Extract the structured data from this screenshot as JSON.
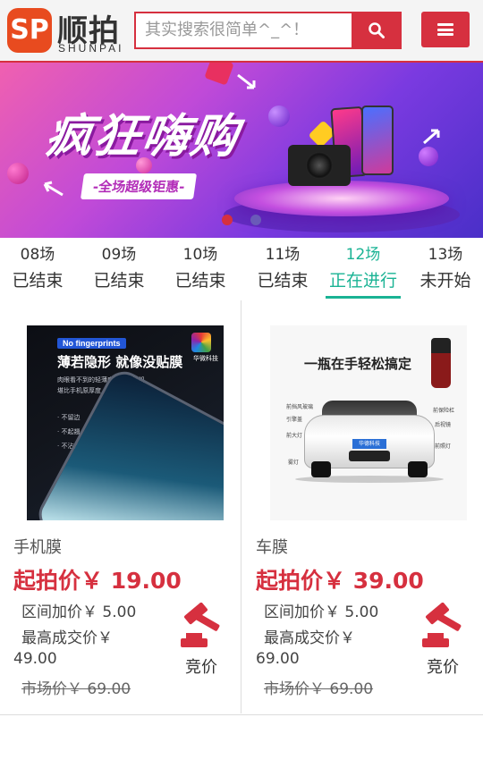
{
  "header": {
    "logo_mark": "SP",
    "logo_cn": "顺拍",
    "logo_en": "SHUNPAI",
    "search_placeholder": "其实搜索很简单^_^！",
    "search_icon": "search-icon",
    "menu_icon": "hamburger-menu-icon",
    "accent_color": "#d6303f"
  },
  "banner": {
    "title": "疯狂嗨购",
    "subtitle": "-全场超级钜惠-",
    "slide_count": 2,
    "active_slide": 1
  },
  "sessions": [
    {
      "time": "08场",
      "status": "已结束"
    },
    {
      "time": "09场",
      "status": "已结束"
    },
    {
      "time": "10场",
      "status": "已结束"
    },
    {
      "time": "11场",
      "status": "已结束"
    },
    {
      "time": "12场",
      "status": "正在进行"
    },
    {
      "time": "13场",
      "status": "未开始"
    }
  ],
  "active_session_color": "#1ab394",
  "products": [
    {
      "name": "手机膜",
      "start_price": "起拍价￥ 19.00",
      "increment": "区间加价￥ 5.00",
      "highest_label": "最高成交价￥",
      "highest_value": "49.00",
      "market_price": "市场价￥ 69.00",
      "bid_label": "竞价",
      "bid_icon": "auction-gavel-icon",
      "image": {
        "badge": "No fingerprints",
        "title": "薄若隐形 就像没贴膜",
        "desc_line1": "肉眼看不到的轻薄度，不怕摔机",
        "desc_line2": "堪比手机原厚度",
        "bullets": [
          "· 不留边",
          "· 不起翘",
          "· 不沾指"
        ],
        "brand": "华微科技"
      }
    },
    {
      "name": "车膜",
      "start_price": "起拍价￥ 39.00",
      "increment": "区间加价￥ 5.00",
      "highest_label": "最高成交价￥",
      "highest_value": "69.00",
      "market_price": "市场价￥ 69.00",
      "bid_label": "竞价",
      "bid_icon": "auction-gavel-icon",
      "image": {
        "title": "一瓶在手轻松搞定",
        "plate": "华德科技",
        "labels": [
          "前挡风玻璃",
          "引擎盖",
          "前大灯",
          "雾灯",
          "前保险杠",
          "后视镜",
          "前照灯",
          "后视镜"
        ]
      }
    }
  ]
}
